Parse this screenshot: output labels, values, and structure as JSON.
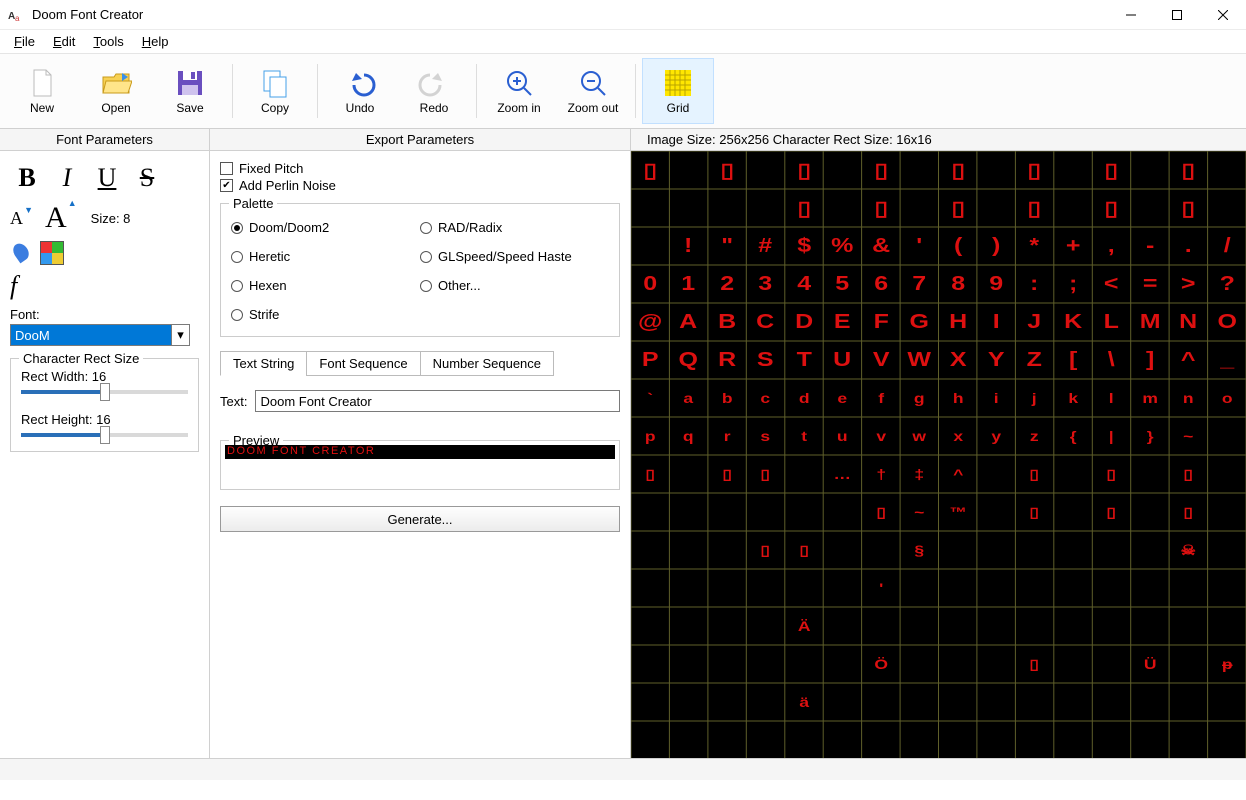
{
  "window": {
    "title": "Doom Font Creator"
  },
  "menu": {
    "file": "File",
    "edit": "Edit",
    "tools": "Tools",
    "help": "Help"
  },
  "toolbar": {
    "new": "New",
    "open": "Open",
    "save": "Save",
    "copy": "Copy",
    "undo": "Undo",
    "redo": "Redo",
    "zoomin": "Zoom in",
    "zoomout": "Zoom out",
    "grid": "Grid"
  },
  "leftPanel": {
    "title": "Font Parameters",
    "sizeLabel": "Size: 8",
    "fontLabel": "Font:",
    "fontValue": "DooM",
    "rectGroup": "Character Rect Size",
    "rectWidthLabel": "Rect Width:  16",
    "rectHeightLabel": "Rect Height: 16"
  },
  "midPanel": {
    "title": "Export Parameters",
    "fixedPitch": "Fixed Pitch",
    "perlin": "Add Perlin Noise",
    "paletteTitle": "Palette",
    "palettes": {
      "doom": "Doom/Doom2",
      "rad": "RAD/Radix",
      "heretic": "Heretic",
      "glspeed": "GLSpeed/Speed Haste",
      "hexen": "Hexen",
      "other": "Other...",
      "strife": "Strife"
    },
    "tabs": {
      "text": "Text String",
      "seq": "Font Sequence",
      "num": "Number Sequence"
    },
    "textLabel": "Text:",
    "textValue": "Doom Font Creator",
    "previewTitle": "Preview",
    "previewText": "Doom Font Creator",
    "generate": "Generate..."
  },
  "rightPanel": {
    "info": "Image Size: 256x256  Character Rect Size: 16x16",
    "rows": [
      [
        "▯",
        "",
        "▯",
        "",
        "▯",
        "",
        "▯",
        "",
        "▯",
        "",
        "▯",
        "",
        "▯",
        "",
        "▯",
        ""
      ],
      [
        "",
        "",
        "",
        "",
        "▯",
        "",
        "▯",
        "",
        "▯",
        "",
        "▯",
        "",
        "▯",
        "",
        "▯",
        ""
      ],
      [
        "",
        "!",
        "\"",
        "#",
        "$",
        "%",
        "&",
        "'",
        "(",
        ")",
        "*",
        "+",
        ",",
        "-",
        ".",
        "/"
      ],
      [
        "0",
        "1",
        "2",
        "3",
        "4",
        "5",
        "6",
        "7",
        "8",
        "9",
        ":",
        ";",
        "<",
        "=",
        ">",
        "?"
      ],
      [
        "@",
        "A",
        "B",
        "C",
        "D",
        "E",
        "F",
        "G",
        "H",
        "I",
        "J",
        "K",
        "L",
        "M",
        "N",
        "O"
      ],
      [
        "P",
        "Q",
        "R",
        "S",
        "T",
        "U",
        "V",
        "W",
        "X",
        "Y",
        "Z",
        "[",
        "\\",
        "]",
        "^",
        "_"
      ],
      [
        "`",
        "a",
        "b",
        "c",
        "d",
        "e",
        "f",
        "g",
        "h",
        "i",
        "j",
        "k",
        "l",
        "m",
        "n",
        "o"
      ],
      [
        "p",
        "q",
        "r",
        "s",
        "t",
        "u",
        "v",
        "w",
        "x",
        "y",
        "z",
        "{",
        "|",
        "}",
        "~",
        ""
      ],
      [
        "▯",
        "",
        "▯",
        "▯",
        "",
        "…",
        "†",
        "‡",
        "^",
        "",
        "▯",
        "",
        "▯",
        "",
        "▯",
        ""
      ],
      [
        "",
        "",
        "",
        "",
        "",
        "",
        "▯",
        "~",
        "™",
        "",
        "▯",
        "",
        "▯",
        "",
        "▯",
        ""
      ],
      [
        "",
        "",
        "",
        "▯",
        "▯",
        "",
        "",
        "§",
        "",
        "",
        "",
        "",
        "",
        "",
        "☠",
        ""
      ],
      [
        "",
        "",
        "",
        "",
        "",
        "",
        "'",
        "",
        "",
        "",
        "",
        "",
        "",
        "",
        "",
        ""
      ],
      [
        "",
        "",
        "",
        "",
        "Ä",
        "",
        "",
        "",
        "",
        "",
        "",
        "",
        "",
        "",
        "",
        ""
      ],
      [
        "",
        "",
        "",
        "",
        "",
        "",
        "Ö",
        "",
        "",
        "",
        "▯",
        "",
        "",
        "Ü",
        "",
        "ᵽ"
      ],
      [
        "",
        "",
        "",
        "",
        "ä",
        "",
        "",
        "",
        "",
        "",
        "",
        "",
        "",
        "",
        "",
        ""
      ]
    ]
  }
}
